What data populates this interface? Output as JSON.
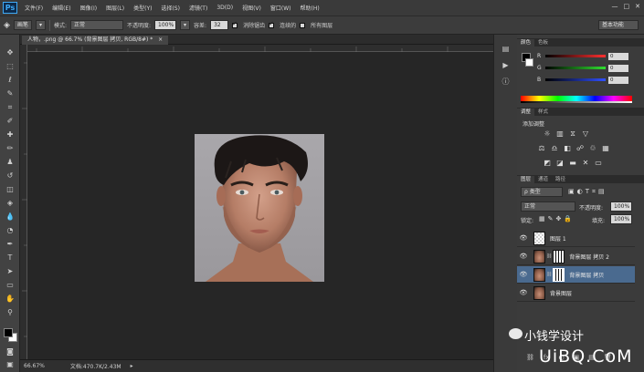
{
  "menubar": {
    "logo": "Ps",
    "items": [
      "文件(F)",
      "编辑(E)",
      "图像(I)",
      "图层(L)",
      "类型(Y)",
      "选择(S)",
      "滤镜(T)",
      "3D(D)",
      "视图(V)",
      "窗口(W)",
      "帮助(H)"
    ],
    "window_controls": [
      "—",
      "□",
      "✕"
    ]
  },
  "options": {
    "tool_dropdown": "画笔",
    "mode_label": "模式:",
    "mode_value": "正常",
    "opacity_label": "不透明度:",
    "opacity_value": "100%",
    "tolerance_label": "容差:",
    "tolerance_value": "32",
    "antialias_label": "消除锯齿",
    "contiguous_label": "连续的",
    "all_layers_label": "所有图层",
    "workspace": "基本功能"
  },
  "document": {
    "tab_label": "人物，.png @ 66.7% (背景图层 拷贝, RGB/8#) *",
    "close_glyph": "×"
  },
  "status": {
    "zoom": "66.67%",
    "doc_info": "文档:470.7K/2.43M",
    "arrow": "▸"
  },
  "color_panel": {
    "tabs": [
      "颜色",
      "色板"
    ],
    "channels": [
      {
        "label": "R",
        "value": "0",
        "color": "#ff3030"
      },
      {
        "label": "G",
        "value": "0",
        "color": "#30e030"
      },
      {
        "label": "B",
        "value": "0",
        "color": "#3050ff"
      }
    ]
  },
  "adjust_panel": {
    "tabs": [
      "调整",
      "样式"
    ],
    "title": "添加调整",
    "row1": [
      "☼",
      "▥",
      "⧖",
      "▽"
    ],
    "row2": [
      "⚖",
      "♎",
      "◧",
      "☍",
      "♲",
      "▦"
    ],
    "row3": [
      "◩",
      "◪",
      "▬",
      "✕",
      "▭"
    ]
  },
  "layers_panel": {
    "tabs": [
      "图层",
      "通道",
      "路径"
    ],
    "kind_label": "ρ 类型",
    "blend_mode": "正常",
    "opacity_label": "不透明度:",
    "opacity_value": "100%",
    "lock_label": "锁定:",
    "fill_label": "填充:",
    "fill_value": "100%",
    "layers": [
      {
        "name": "图层 1",
        "thumb": "checker",
        "selected": false
      },
      {
        "name": "背景图层 拷贝 2",
        "thumb": "face-mask",
        "selected": false
      },
      {
        "name": "背景图层 拷贝",
        "thumb": "face-mask",
        "selected": true
      },
      {
        "name": "背景图层",
        "thumb": "face",
        "selected": false
      }
    ],
    "bottom_icons": [
      "⛓",
      "fx",
      "◐",
      "▣",
      "▤",
      "🗑"
    ]
  },
  "watermark": {
    "line1": "小钱学设计",
    "line2": "UiBQ.CoM"
  },
  "colors": {
    "panel_bg": "#3b3b3b",
    "canvas_bg": "#262626",
    "selection": "#4a6a8f"
  }
}
